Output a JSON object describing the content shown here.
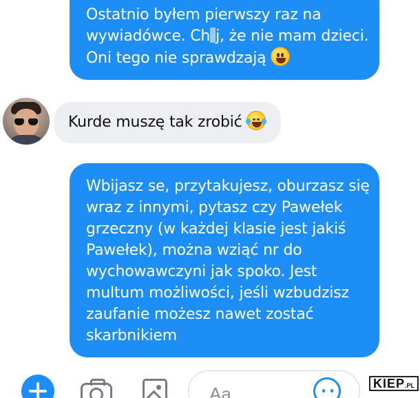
{
  "conversation": {
    "messages": [
      {
        "direction": "outgoing",
        "lines": [
          "Ostatnio byłem pierwszy raz na",
          "wywiadówce. Ch",
          "j, że nie mam dzieci.",
          "Oni tego nie sprawdzają"
        ],
        "emoji": "grinning-face"
      },
      {
        "direction": "incoming",
        "text": "Kurde muszę tak zrobić",
        "emoji": "tears-of-joy"
      },
      {
        "direction": "outgoing",
        "lines": [
          "Wbijasz se, przytakujesz, oburzasz się",
          "wraz z innymi, pytasz czy Pawełek",
          "grzeczny (w każdej klasie jest jakiś",
          "Pawełek), można wziąć nr do",
          "wychowawczyni jak spoko. Jest",
          "multum możliwości, jeśli wzbudzisz",
          "zaufanie możesz nawet zostać",
          "skarbnikiem"
        ]
      }
    ]
  },
  "composer": {
    "placeholder": "Aa",
    "icons": [
      "plus-icon",
      "camera-icon",
      "image-icon",
      "smiley-icon"
    ]
  },
  "watermark": {
    "text": "KIEP",
    "suffix": ".PL"
  },
  "colors": {
    "outgoing_bubble": "#1d8ef5",
    "incoming_bubble": "#eeeff2",
    "accent": "#1d8ef5"
  }
}
